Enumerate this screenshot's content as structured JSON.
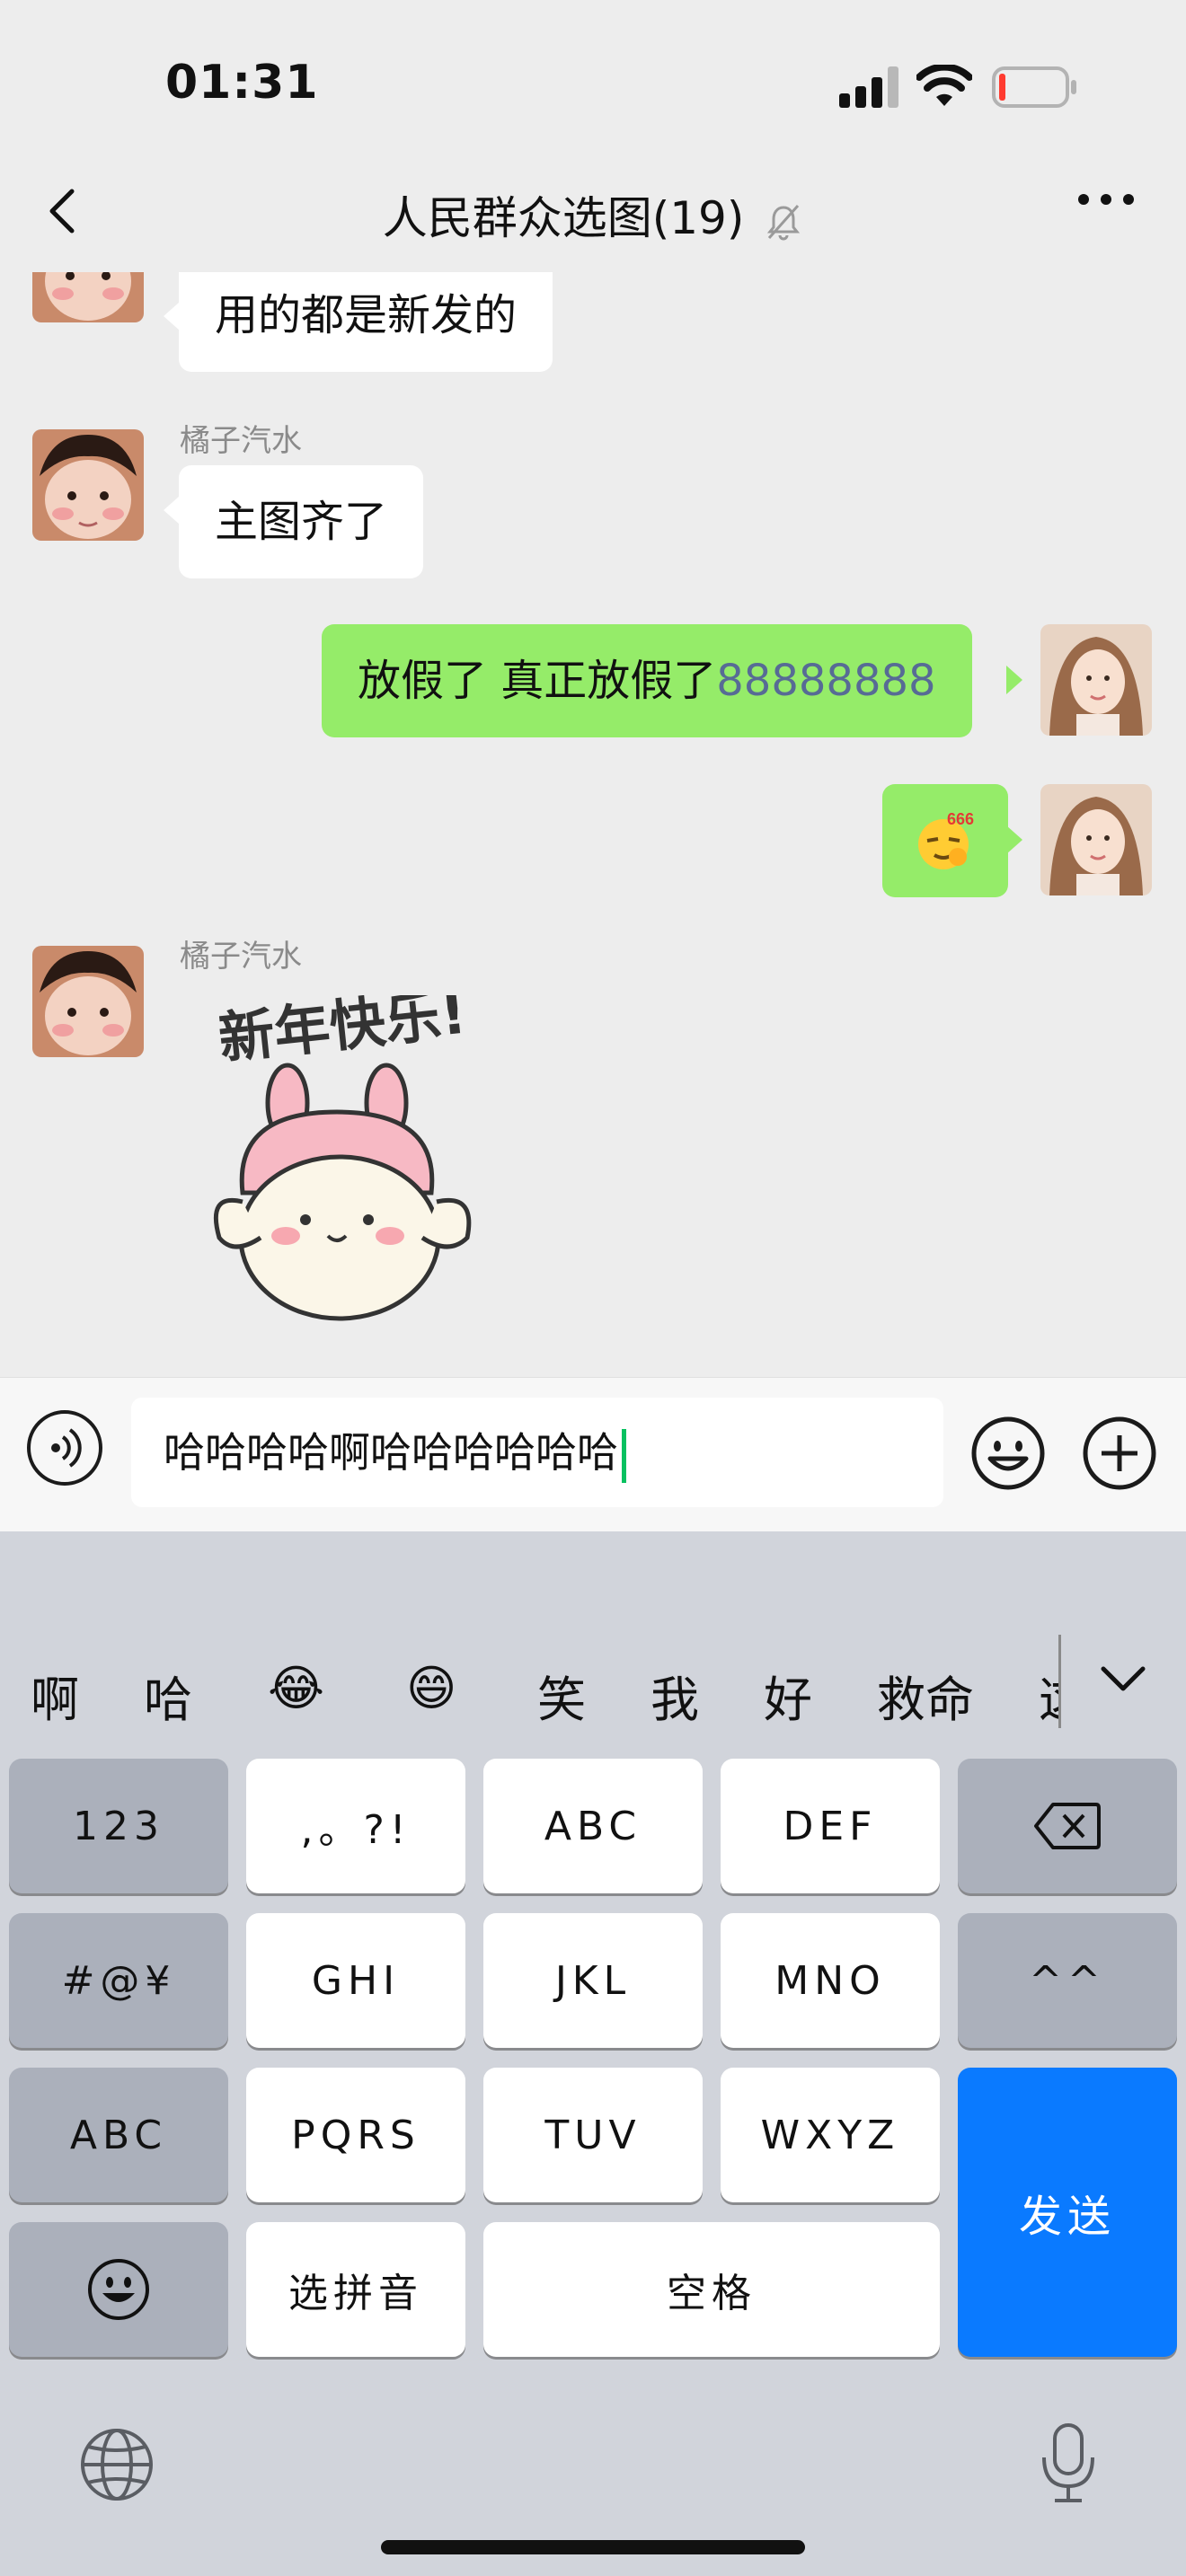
{
  "status_bar": {
    "time": "01:31"
  },
  "nav": {
    "title": "人民群众选图",
    "member_count": "(19)"
  },
  "messages": [
    {
      "sender": "",
      "text": "用的都是新发的",
      "direction": "in"
    },
    {
      "sender": "橘子汽水",
      "text": "主图齐了",
      "direction": "in"
    },
    {
      "sender": "",
      "text_prefix": "放假了 真正放假了",
      "text_number": "88888888",
      "direction": "out"
    },
    {
      "sender": "",
      "sticker": "666-emoji",
      "direction": "out"
    },
    {
      "sender": "橘子汽水",
      "sticker": "bunny-new-year-sticker",
      "sticker_text": "新年快乐!",
      "direction": "in"
    }
  ],
  "input": {
    "value": "哈哈哈哈啊哈哈哈哈哈哈"
  },
  "keyboard": {
    "candidates": [
      "啊",
      "哈",
      "😂",
      "😄",
      "笑",
      "我",
      "好",
      "救命",
      "这"
    ],
    "rows": [
      [
        "123",
        ",。?!",
        "ABC",
        "DEF",
        "⌫"
      ],
      [
        "#@¥",
        "GHI",
        "JKL",
        "MNO",
        "^^"
      ],
      [
        "ABC",
        "PQRS",
        "TUV",
        "WXYZ"
      ],
      [
        "☺",
        "选拼音",
        "空格"
      ]
    ],
    "send": "发送"
  },
  "colors": {
    "bubble_out": "#95ec69",
    "bubble_in": "#ffffff",
    "send_key": "#0a7aff",
    "number_link": "#576b95"
  }
}
